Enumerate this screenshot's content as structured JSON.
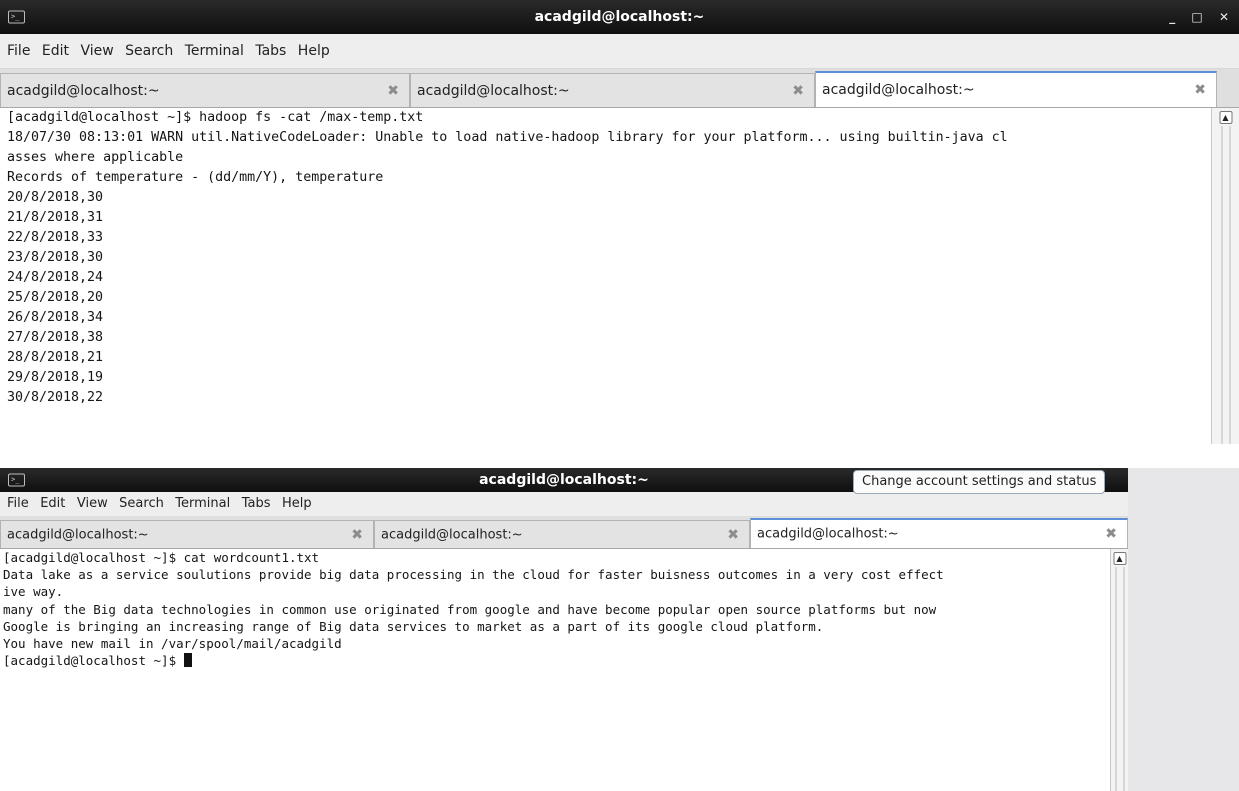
{
  "window1": {
    "title": "acadgild@localhost:~",
    "menu": [
      "File",
      "Edit",
      "View",
      "Search",
      "Terminal",
      "Tabs",
      "Help"
    ],
    "tabs": [
      {
        "label": "acadgild@localhost:~",
        "active": false
      },
      {
        "label": "acadgild@localhost:~",
        "active": false
      },
      {
        "label": "acadgild@localhost:~",
        "active": true
      }
    ],
    "lines": [
      "[acadgild@localhost ~]$ hadoop fs -cat /max-temp.txt",
      "18/07/30 08:13:01 WARN util.NativeCodeLoader: Unable to load native-hadoop library for your platform... using builtin-java cl",
      "asses where applicable",
      "Records of temperature - (dd/mm/Y), temperature",
      "",
      "20/8/2018,30",
      "21/8/2018,31",
      "22/8/2018,33",
      "23/8/2018,30",
      "24/8/2018,24",
      "25/8/2018,20",
      "26/8/2018,34",
      "27/8/2018,38",
      "28/8/2018,21",
      "29/8/2018,19",
      "30/8/2018,22"
    ]
  },
  "window2": {
    "title": "acadgild@localhost:~",
    "tooltip": "Change account settings and status",
    "menu": [
      "File",
      "Edit",
      "View",
      "Search",
      "Terminal",
      "Tabs",
      "Help"
    ],
    "tabs": [
      {
        "label": "acadgild@localhost:~",
        "active": false
      },
      {
        "label": "acadgild@localhost:~",
        "active": false
      },
      {
        "label": "acadgild@localhost:~",
        "active": true
      }
    ],
    "lines": [
      "[acadgild@localhost ~]$ cat wordcount1.txt",
      "Data lake as a service soulutions provide big data processing in the cloud for faster buisness outcomes in a very cost effect",
      "ive way.",
      "many of the Big data technologies in common use originated from google and have become popular open source platforms but now",
      "Google is bringing an increasing range of Big data services to market as a part of its google cloud platform.",
      "You have new mail in /var/spool/mail/acadgild"
    ],
    "prompt": "[acadgild@localhost ~]$ "
  },
  "icons": {
    "terminal": "terminal-icon",
    "tab_close": "close-icon",
    "scroll_up": "scroll-up-arrow-icon"
  },
  "colors": {
    "titlebar": "#1a1a1a",
    "active_tab_accent": "#5c8fd6",
    "text": "#151515"
  }
}
